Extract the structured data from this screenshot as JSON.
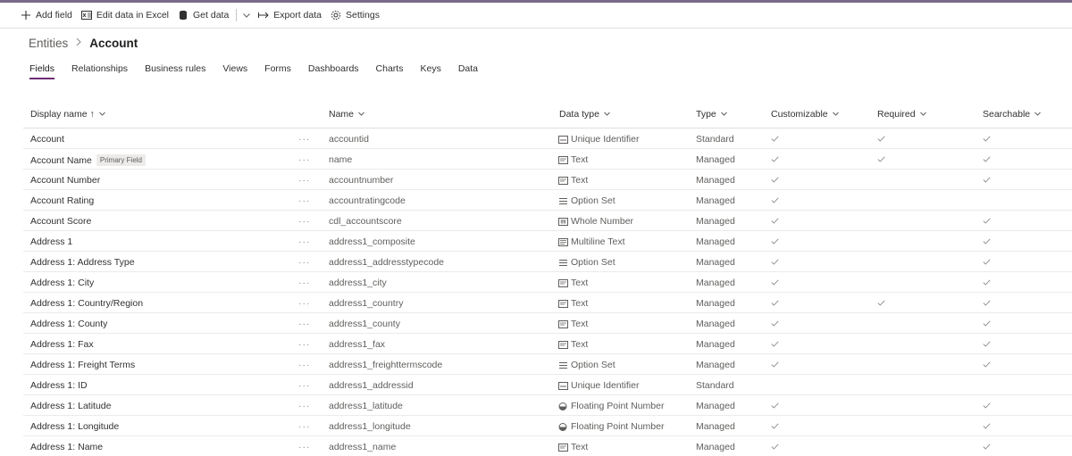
{
  "toolbar": {
    "add_field": "Add field",
    "edit_excel": "Edit data in Excel",
    "get_data": "Get data",
    "export_data": "Export data",
    "settings": "Settings"
  },
  "breadcrumb": {
    "parent": "Entities",
    "current": "Account"
  },
  "tabs": [
    {
      "label": "Fields",
      "active": true
    },
    {
      "label": "Relationships"
    },
    {
      "label": "Business rules"
    },
    {
      "label": "Views"
    },
    {
      "label": "Forms"
    },
    {
      "label": "Dashboards"
    },
    {
      "label": "Charts"
    },
    {
      "label": "Keys"
    },
    {
      "label": "Data"
    }
  ],
  "columns": {
    "display": "Display name ↑",
    "name": "Name",
    "dtype": "Data type",
    "type": "Type",
    "customizable": "Customizable",
    "required": "Required",
    "searchable": "Searchable"
  },
  "more_glyph": "···",
  "primary_badge": "Primary Field",
  "colors": {
    "accent": "#6b2c72",
    "check": "#8a8886",
    "border": "#edebe9"
  },
  "rows": [
    {
      "display": "Account",
      "name": "accountid",
      "dtype": "Unique Identifier",
      "dicon": "uid-icon",
      "type": "Standard",
      "cust": true,
      "req": true,
      "search": true
    },
    {
      "display": "Account Name",
      "primary": true,
      "name": "name",
      "dtype": "Text",
      "dicon": "text-icon",
      "type": "Managed",
      "cust": true,
      "req": true,
      "search": true
    },
    {
      "display": "Account Number",
      "name": "accountnumber",
      "dtype": "Text",
      "dicon": "text-icon",
      "type": "Managed",
      "cust": true,
      "req": false,
      "search": true
    },
    {
      "display": "Account Rating",
      "name": "accountratingcode",
      "dtype": "Option Set",
      "dicon": "optionset-icon",
      "type": "Managed",
      "cust": true,
      "req": false,
      "search": false
    },
    {
      "display": "Account Score",
      "name": "cdl_accountscore",
      "dtype": "Whole Number",
      "dicon": "number-icon",
      "type": "Managed",
      "cust": true,
      "req": false,
      "search": true
    },
    {
      "display": "Address 1",
      "name": "address1_composite",
      "dtype": "Multiline Text",
      "dicon": "multiline-icon",
      "type": "Managed",
      "cust": true,
      "req": false,
      "search": true
    },
    {
      "display": "Address 1: Address Type",
      "name": "address1_addresstypecode",
      "dtype": "Option Set",
      "dicon": "optionset-icon",
      "type": "Managed",
      "cust": true,
      "req": false,
      "search": true
    },
    {
      "display": "Address 1: City",
      "name": "address1_city",
      "dtype": "Text",
      "dicon": "text-icon",
      "type": "Managed",
      "cust": true,
      "req": false,
      "search": true
    },
    {
      "display": "Address 1: Country/Region",
      "name": "address1_country",
      "dtype": "Text",
      "dicon": "text-icon",
      "type": "Managed",
      "cust": true,
      "req": true,
      "search": true
    },
    {
      "display": "Address 1: County",
      "name": "address1_county",
      "dtype": "Text",
      "dicon": "text-icon",
      "type": "Managed",
      "cust": true,
      "req": false,
      "search": true
    },
    {
      "display": "Address 1: Fax",
      "name": "address1_fax",
      "dtype": "Text",
      "dicon": "text-icon",
      "type": "Managed",
      "cust": true,
      "req": false,
      "search": true
    },
    {
      "display": "Address 1: Freight Terms",
      "name": "address1_freighttermscode",
      "dtype": "Option Set",
      "dicon": "optionset-icon",
      "type": "Managed",
      "cust": true,
      "req": false,
      "search": true
    },
    {
      "display": "Address 1: ID",
      "name": "address1_addressid",
      "dtype": "Unique Identifier",
      "dicon": "uid-icon",
      "type": "Standard",
      "cust": false,
      "req": false,
      "search": false
    },
    {
      "display": "Address 1: Latitude",
      "name": "address1_latitude",
      "dtype": "Floating Point Number",
      "dicon": "float-icon",
      "type": "Managed",
      "cust": true,
      "req": false,
      "search": true
    },
    {
      "display": "Address 1: Longitude",
      "name": "address1_longitude",
      "dtype": "Floating Point Number",
      "dicon": "float-icon",
      "type": "Managed",
      "cust": true,
      "req": false,
      "search": true
    },
    {
      "display": "Address 1: Name",
      "name": "address1_name",
      "dtype": "Text",
      "dicon": "text-icon",
      "type": "Managed",
      "cust": true,
      "req": false,
      "search": true
    }
  ]
}
